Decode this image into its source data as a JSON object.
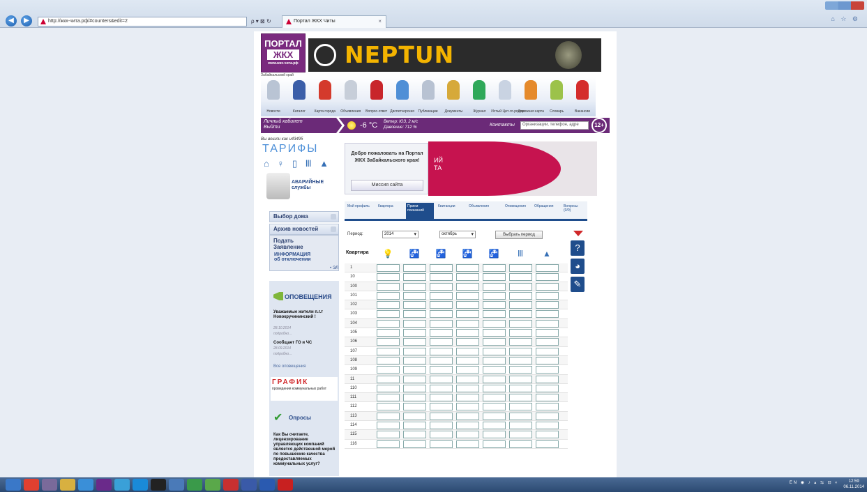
{
  "browser": {
    "address": "http://жкх-чита.рф/#counters&edit=2",
    "search_tools": "ρ ▾ ⊠ ↻",
    "tab_title": "Портал ЖКХ Читы",
    "tab_close": "×",
    "home_icons": "⌂ ☆ ⚙"
  },
  "site": {
    "logo_line1": "ПОРТАЛ",
    "logo_line2": "ЖКХ",
    "logo_line3": "www.жкх-чита.рф",
    "region": "Забайкальский край",
    "banner_text": "NEPTUN"
  },
  "nav_icons": [
    {
      "label": "Новости",
      "color": "#b9c4d4"
    },
    {
      "label": "Каталог",
      "color": "#3b5ea8"
    },
    {
      "label": "Карта города",
      "color": "#d43a2c"
    },
    {
      "label": "Объявления",
      "color": "#c7ced9"
    },
    {
      "label": "Вопрос-ответ",
      "color": "#c8252b"
    },
    {
      "label": "Диспетчерская",
      "color": "#4f8fd6"
    },
    {
      "label": "Публикации",
      "color": "#b8c2d2"
    },
    {
      "label": "Документы",
      "color": "#d6a93a"
    },
    {
      "label": "Журнал",
      "color": "#2fa85a"
    },
    {
      "label": "Истый Цит-гл-рядом",
      "color": "#c9d3e2"
    },
    {
      "label": "Дорожная карта",
      "color": "#e58a2c"
    },
    {
      "label": "Словарь",
      "color": "#9cc24a"
    },
    {
      "label": "Вакансии",
      "color": "#d42c2c"
    }
  ],
  "infobar": {
    "cabinet_line1": "Личный кабинет",
    "cabinet_line2": "Выйти",
    "temperature": "-6 °C",
    "wind": "Ветер: ЮЗ, 2 м/с",
    "pressure": "Давление: 712 %",
    "contacts": "Контакты",
    "search_placeholder": "Организации, телефон, адре",
    "age_badge": "12+"
  },
  "left": {
    "logged_in_as": "Вы вошли как u43495",
    "tariffs": "ТАРИФЫ",
    "tariff_icons": "⌂ ♀ ▯ Ⅲ ▲",
    "emergency": "АВАРИЙНЫЕ службы",
    "choose_house": "Выбор дома",
    "news_archive": "Архив новостей",
    "submit_line1": "Подать",
    "submit_line2": "Заявление",
    "info_line1": "ИНФОРМАЦИЯ",
    "info_line2": "об отключении",
    "info_more": "• ЭЛ",
    "notifications_title": "ОПОВЕЩЕНИЯ",
    "notices": [
      {
        "title": "Уважаемые жители п.г.т Новокручининский !",
        "date": "28.10.2014",
        "more": "подробно..."
      },
      {
        "title": "Сообщает ГО и ЧС",
        "date": "28.09.2014",
        "more": "подробно..."
      }
    ],
    "all_notices": "Все оповещения",
    "schedule_title": "ГРАФИК",
    "schedule_sub": "проведения коммунальных работ",
    "polls_title": "Опросы",
    "poll_question": "Как Вы считаете, лицензирование управляющих компаний является действенной мерой по повышению качества предоставляемых коммунальных услуг?"
  },
  "welcome": {
    "text": "Добро пожаловать на Портал ЖКХ Забайкальского края!",
    "mission_button": "Миссия сайта",
    "slide_text_1": "ИЙ",
    "slide_text_2": "ТА"
  },
  "tabs": [
    {
      "label": "Мой профиль",
      "active": false
    },
    {
      "label": "Квартира",
      "active": false
    },
    {
      "label": "Прием показаний",
      "active": true
    },
    {
      "label": "Квитанции",
      "active": false
    },
    {
      "label": "Объявления",
      "active": false
    },
    {
      "label": "Оповещения",
      "active": false
    },
    {
      "label": "Обращения",
      "active": false
    },
    {
      "label": "Вопросы (0/0)",
      "active": false
    }
  ],
  "filter": {
    "period_label": "Период:",
    "year": "2014",
    "month": "октябрь",
    "choose_period": "Выбрать период"
  },
  "table": {
    "header_apartment": "Квартира",
    "meter_icons": [
      "💡",
      "🚰",
      "🚰",
      "🚰",
      "🚰",
      "Ⅲ",
      "▲"
    ],
    "rows": [
      "1",
      "10",
      "100",
      "101",
      "102",
      "103",
      "104",
      "105",
      "106",
      "107",
      "108",
      "109",
      "11",
      "110",
      "111",
      "112",
      "113",
      "114",
      "115",
      "116"
    ]
  },
  "tools": {
    "help": "?",
    "reading": "◕",
    "edit": "✎"
  },
  "taskbar": {
    "tray": "EN ◉ ♪ ▴ ⇆ ⊡ ◐",
    "time": "12:59",
    "date": "06.11.2014"
  }
}
